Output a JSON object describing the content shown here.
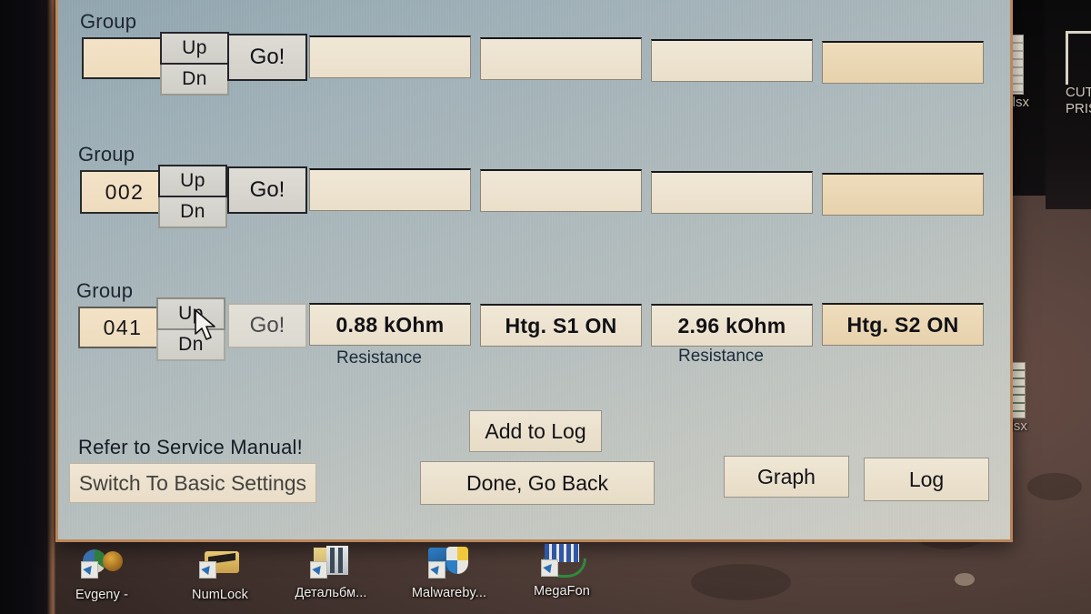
{
  "app": {
    "panel_border_color": "#b8845a",
    "panel_bg_color": "#b4bdbd"
  },
  "groups": [
    {
      "label": "Group",
      "number": "",
      "up_label": "Up",
      "dn_label": "Dn",
      "go_label": "Go!",
      "fields": [
        "",
        "",
        "",
        ""
      ],
      "sub_labels": [
        "",
        ""
      ]
    },
    {
      "label": "Group",
      "number": "002",
      "up_label": "Up",
      "dn_label": "Dn",
      "go_label": "Go!",
      "fields": [
        "",
        "",
        "",
        ""
      ],
      "sub_labels": [
        "",
        ""
      ]
    },
    {
      "label": "Group",
      "number": "041",
      "up_label": "Up",
      "dn_label": "Dn",
      "go_label": "Go!",
      "fields": [
        "0.88 kOhm",
        "Htg. S1 ON",
        "2.96 kOhm",
        "Htg. S2 ON"
      ],
      "sub_labels": [
        "Resistance",
        "Resistance"
      ]
    }
  ],
  "footer": {
    "service_note": "Refer to Service Manual!",
    "switch_basic_label": "Switch To Basic Settings",
    "add_to_log_label": "Add to Log",
    "done_go_back_label": "Done, Go Back",
    "graph_label": "Graph",
    "log_label": "Log"
  },
  "desktop": {
    "icons": [
      {
        "name": "Evgeny -"
      },
      {
        "name": "NumLock"
      },
      {
        "name": "Детальбм..."
      },
      {
        "name": "Malwareby..."
      },
      {
        "name": "MegaFon"
      }
    ],
    "edge_icons": [
      {
        "name": ".xlsx"
      },
      {
        "name": "CUT"
      },
      {
        "name": "PRIS"
      },
      {
        "name": "xlsx"
      }
    ]
  }
}
